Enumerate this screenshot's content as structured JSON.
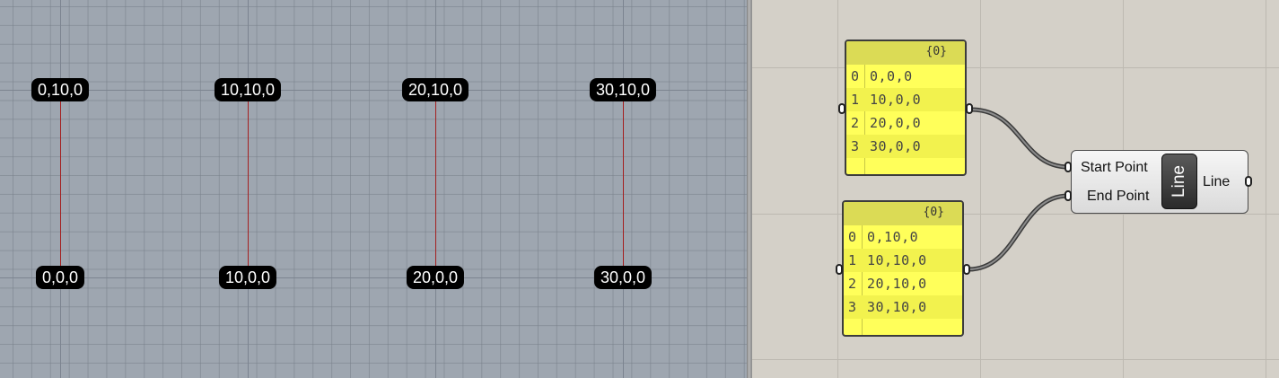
{
  "viewport": {
    "top_labels": [
      "0,10,0",
      "10,10,0",
      "20,10,0",
      "30,10,0"
    ],
    "bottom_labels": [
      "0,0,0",
      "10,0,0",
      "20,0,0",
      "30,0,0"
    ]
  },
  "canvas": {
    "panel_a": {
      "path": "{0}",
      "rows": [
        {
          "index": "0",
          "value": "0,0,0"
        },
        {
          "index": "1",
          "value": "10,0,0"
        },
        {
          "index": "2",
          "value": "20,0,0"
        },
        {
          "index": "3",
          "value": "30,0,0"
        }
      ]
    },
    "panel_b": {
      "path": "{0}",
      "rows": [
        {
          "index": "0",
          "value": "0,10,0"
        },
        {
          "index": "1",
          "value": "10,10,0"
        },
        {
          "index": "2",
          "value": "20,10,0"
        },
        {
          "index": "3",
          "value": "30,10,0"
        }
      ]
    },
    "line_component": {
      "input_start": "Start Point",
      "input_end": "End Point",
      "name": "Line",
      "output": "Line"
    }
  },
  "colors": {
    "viewport_bg": "#9ea6b0",
    "line_color": "#a42020",
    "panel_yellow": "#ffff5a",
    "canvas_bg": "#d4d0c8"
  }
}
